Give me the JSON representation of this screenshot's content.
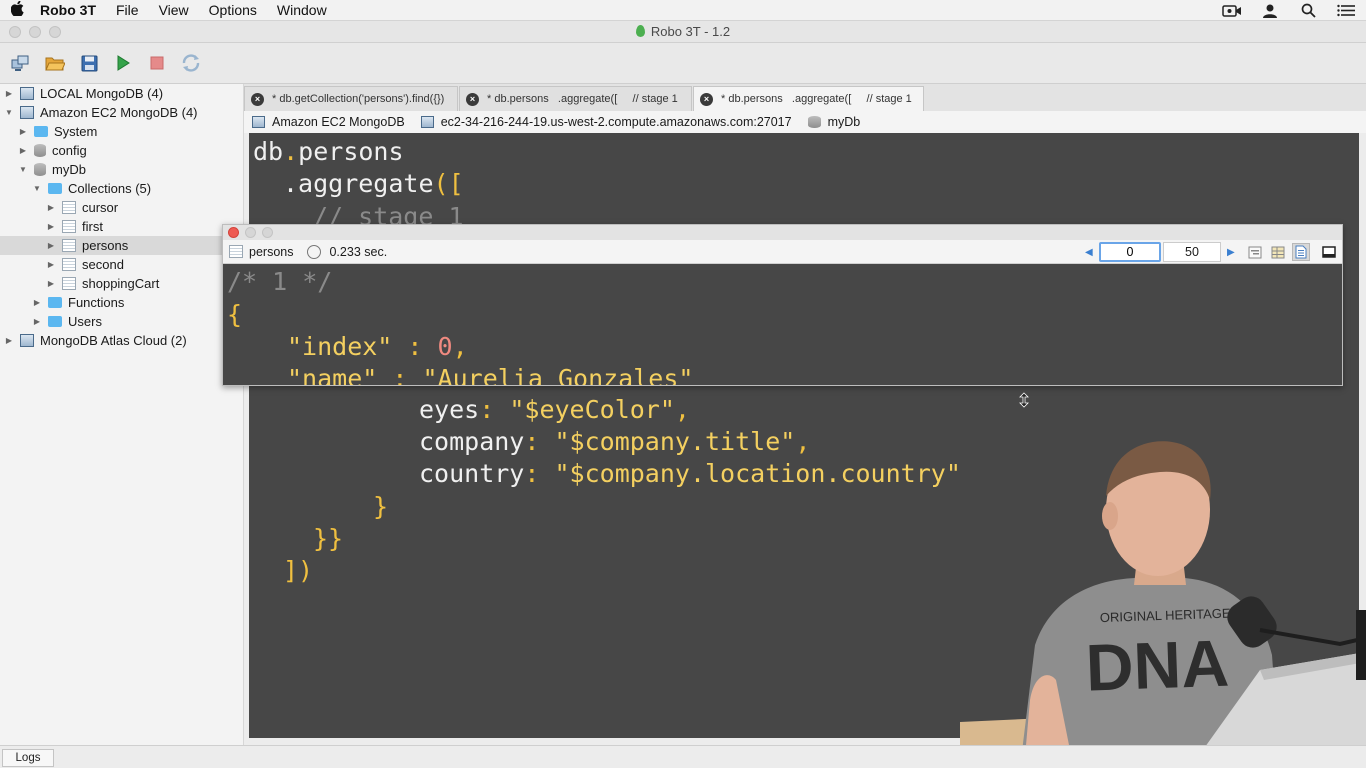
{
  "menubar": {
    "app_name": "Robo 3T",
    "items": [
      "File",
      "View",
      "Options",
      "Window"
    ],
    "right_icons": [
      "camera-icon",
      "user-icon",
      "search-icon",
      "list-icon"
    ]
  },
  "window": {
    "title": "Robo 3T - 1.2"
  },
  "toolbar": {
    "buttons": [
      "connect-icon",
      "open-icon",
      "save-icon",
      "run-icon",
      "stop-icon",
      "refresh-icon"
    ]
  },
  "sidebar": {
    "items": [
      {
        "label": "LOCAL MongoDB (4)",
        "icon": "server-icon"
      },
      {
        "label": "Amazon EC2 MongoDB (4)",
        "icon": "server-icon"
      },
      {
        "label": "System",
        "icon": "folder-icon"
      },
      {
        "label": "config",
        "icon": "database-icon"
      },
      {
        "label": "myDb",
        "icon": "database-icon"
      },
      {
        "label": "Collections (5)",
        "icon": "folder-icon"
      },
      {
        "label": "cursor",
        "icon": "collection-icon"
      },
      {
        "label": "first",
        "icon": "collection-icon"
      },
      {
        "label": "persons",
        "icon": "collection-icon"
      },
      {
        "label": "second",
        "icon": "collection-icon"
      },
      {
        "label": "shoppingCart",
        "icon": "collection-icon"
      },
      {
        "label": "Functions",
        "icon": "folder-icon"
      },
      {
        "label": "Users",
        "icon": "folder-icon"
      },
      {
        "label": "MongoDB Atlas Cloud (2)",
        "icon": "server-icon"
      }
    ],
    "selected": "persons"
  },
  "tabs": [
    {
      "label": "* db.getCollection('persons').find({})"
    },
    {
      "label": "* db.persons   .aggregate([     // stage 1"
    },
    {
      "label": "* db.persons   .aggregate([     // stage 1"
    }
  ],
  "connection": {
    "server": "Amazon EC2 MongoDB",
    "host": "ec2-34-216-244-19.us-west-2.compute.amazonaws.com:27017",
    "database": "myDb"
  },
  "editor": {
    "line1_obj": "db",
    "line1_dot": ".",
    "line1_prop": "persons",
    "line2_fn": ".aggregate",
    "line2_open": "([",
    "line3_comment": "// stage 1",
    "line_eyes_key": "eyes",
    "line_eyes_val": "\"$eyeColor\"",
    "line_company_key": "company",
    "line_company_val": "\"$company.title\"",
    "line_country_key": "country",
    "line_country_val": "\"$company.location.country\"",
    "close_brace": "}",
    "close_double": "}}",
    "close_bracket": "])",
    "colon": ":",
    "comma": ","
  },
  "result": {
    "collection": "persons",
    "time": "0.233 sec.",
    "page_start": "0",
    "page_size": "50",
    "doc_comment": "/* 1 */",
    "open_brace": "{",
    "index_key": "\"index\"",
    "index_value": "0",
    "name_key": "\"name\"",
    "name_value": "\"Aurelia Gonzales\""
  },
  "statusbar": {
    "logs_label": "Logs"
  }
}
